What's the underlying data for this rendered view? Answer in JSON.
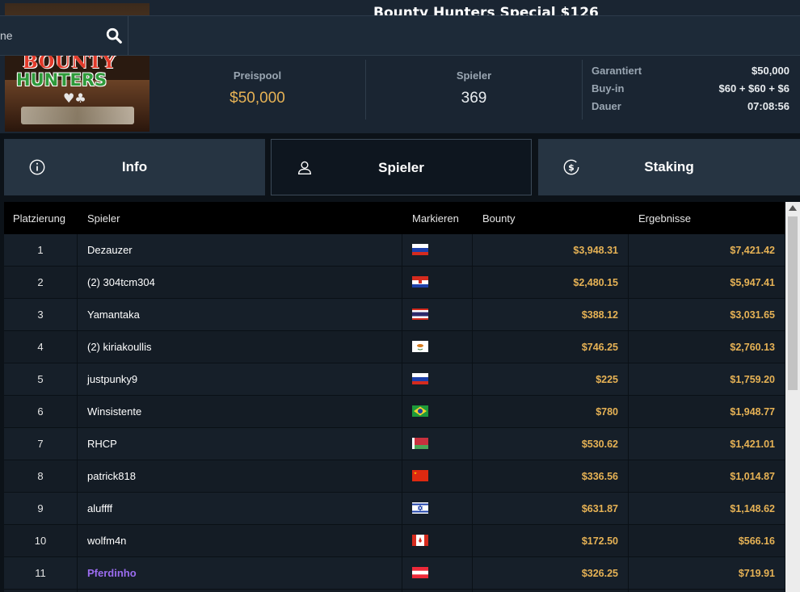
{
  "header": {
    "title": "Bounty Hunters Special $126",
    "logo_text_top": "BOUNTY",
    "logo_text_bottom": "HUNTERS"
  },
  "search": {
    "placeholder": "ne",
    "value": ""
  },
  "stats": {
    "prizepool_label": "Preispool",
    "prizepool_value": "$50,000",
    "players_label": "Spieler",
    "players_value": "369"
  },
  "details": {
    "guaranteed_label": "Garantiert",
    "guaranteed_value": "$50,000",
    "buyin_label": "Buy-in",
    "buyin_value": "$60 + $60 + $6",
    "duration_label": "Dauer",
    "duration_value": "07:08:56"
  },
  "tabs": [
    {
      "label": "Info",
      "icon": "info-icon",
      "active": false
    },
    {
      "label": "Spieler",
      "icon": "user-icon",
      "active": true
    },
    {
      "label": "Staking",
      "icon": "dollar-icon",
      "active": false
    }
  ],
  "table": {
    "headers": {
      "rank": "Platzierung",
      "player": "Spieler",
      "flag": "Markieren",
      "bounty": "Bounty",
      "result": "Ergebnisse"
    },
    "rows": [
      {
        "rank": "1",
        "name": "Dezauzer",
        "flag": "russia",
        "bounty": "$3,948.31",
        "result": "$7,421.42",
        "highlight": false
      },
      {
        "rank": "2",
        "name": "(2) 304tcm304",
        "flag": "croatia",
        "bounty": "$2,480.15",
        "result": "$5,947.41",
        "highlight": false
      },
      {
        "rank": "3",
        "name": "Yamantaka",
        "flag": "thailand",
        "bounty": "$388.12",
        "result": "$3,031.65",
        "highlight": false
      },
      {
        "rank": "4",
        "name": "(2) kiriakoullis",
        "flag": "cyprus",
        "bounty": "$746.25",
        "result": "$2,760.13",
        "highlight": false
      },
      {
        "rank": "5",
        "name": "justpunky9",
        "flag": "russia",
        "bounty": "$225",
        "result": "$1,759.20",
        "highlight": false
      },
      {
        "rank": "6",
        "name": "Winsistente",
        "flag": "brazil",
        "bounty": "$780",
        "result": "$1,948.77",
        "highlight": false
      },
      {
        "rank": "7",
        "name": "RHCP",
        "flag": "belarus",
        "bounty": "$530.62",
        "result": "$1,421.01",
        "highlight": false
      },
      {
        "rank": "8",
        "name": "patrick818",
        "flag": "china",
        "bounty": "$336.56",
        "result": "$1,014.87",
        "highlight": false
      },
      {
        "rank": "9",
        "name": "aluffff",
        "flag": "israel",
        "bounty": "$631.87",
        "result": "$1,148.62",
        "highlight": false
      },
      {
        "rank": "10",
        "name": "wolfm4n",
        "flag": "canada",
        "bounty": "$172.50",
        "result": "$566.16",
        "highlight": false
      },
      {
        "rank": "11",
        "name": "Pferdinho",
        "flag": "austria",
        "bounty": "$326.25",
        "result": "$719.91",
        "highlight": true
      }
    ]
  },
  "colors": {
    "accent_gold": "#e6b255",
    "highlight_purple": "#9b6cf0",
    "panel": "#1a2532"
  }
}
